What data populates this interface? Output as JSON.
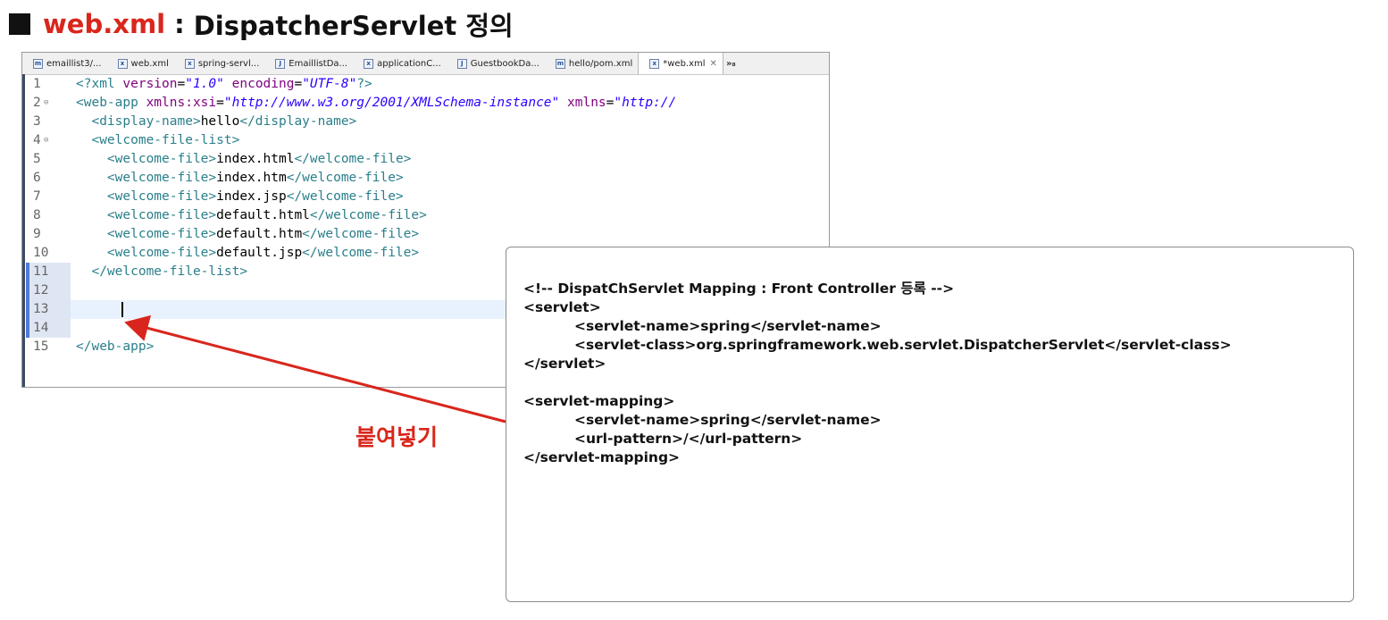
{
  "slide": {
    "title_file": "web.xml",
    "title_separator": ":",
    "title_rest": "DispatcherServlet 정의"
  },
  "colors": {
    "accent_red": "#d9261c",
    "tag_teal": "#2a7f8a",
    "attr_purple": "#7f007f",
    "value_blue": "#2a00ff"
  },
  "editor": {
    "tabs": [
      {
        "label": "emaillist3/...",
        "icon": "maven-pom-icon",
        "icon_letter": "m"
      },
      {
        "label": "web.xml",
        "icon": "xml-file-icon",
        "icon_letter": "x"
      },
      {
        "label": "spring-servl...",
        "icon": "xml-file-icon",
        "icon_letter": "x"
      },
      {
        "label": "EmaillistDa...",
        "icon": "java-file-icon",
        "icon_letter": "J"
      },
      {
        "label": "applicationC...",
        "icon": "xml-file-icon",
        "icon_letter": "x"
      },
      {
        "label": "GuestbookDa...",
        "icon": "java-file-icon",
        "icon_letter": "J"
      },
      {
        "label": "hello/pom.xml",
        "icon": "maven-pom-icon",
        "icon_letter": "m"
      },
      {
        "label": "*web.xml",
        "icon": "xml-file-icon",
        "icon_letter": "x",
        "active": true,
        "close": "✕"
      }
    ],
    "overflow_label": "»₈",
    "lines": [
      {
        "num": "1",
        "tokens": [
          {
            "t": "tag",
            "v": "<?xml "
          },
          {
            "t": "attr",
            "v": "version"
          },
          {
            "t": "txt",
            "v": "="
          },
          {
            "t": "val",
            "v": "\"1.0\""
          },
          {
            "t": "txt",
            "v": " "
          },
          {
            "t": "attr",
            "v": "encoding"
          },
          {
            "t": "txt",
            "v": "="
          },
          {
            "t": "val",
            "v": "\"UTF-8\""
          },
          {
            "t": "tag",
            "v": "?>"
          }
        ]
      },
      {
        "num": "2",
        "fold": "⊖",
        "tokens": [
          {
            "t": "tag",
            "v": "<web-app "
          },
          {
            "t": "attr",
            "v": "xmlns:xsi"
          },
          {
            "t": "txt",
            "v": "="
          },
          {
            "t": "val",
            "v": "\"http://www.w3.org/2001/XMLSchema-instance\""
          },
          {
            "t": "txt",
            "v": " "
          },
          {
            "t": "attr",
            "v": "xmlns"
          },
          {
            "t": "txt",
            "v": "="
          },
          {
            "t": "val",
            "v": "\"http://"
          }
        ]
      },
      {
        "num": "3",
        "tokens": [
          {
            "t": "tag",
            "v": "  <display-name>"
          },
          {
            "t": "txt",
            "v": "hello"
          },
          {
            "t": "tag",
            "v": "</display-name>"
          }
        ]
      },
      {
        "num": "4",
        "fold": "⊖",
        "tokens": [
          {
            "t": "tag",
            "v": "  <welcome-file-list>"
          }
        ]
      },
      {
        "num": "5",
        "tokens": [
          {
            "t": "tag",
            "v": "    <welcome-file>"
          },
          {
            "t": "txt",
            "v": "index.html"
          },
          {
            "t": "tag",
            "v": "</welcome-file>"
          }
        ]
      },
      {
        "num": "6",
        "tokens": [
          {
            "t": "tag",
            "v": "    <welcome-file>"
          },
          {
            "t": "txt",
            "v": "index.htm"
          },
          {
            "t": "tag",
            "v": "</welcome-file>"
          }
        ]
      },
      {
        "num": "7",
        "tokens": [
          {
            "t": "tag",
            "v": "    <welcome-file>"
          },
          {
            "t": "txt",
            "v": "index.jsp"
          },
          {
            "t": "tag",
            "v": "</welcome-file>"
          }
        ]
      },
      {
        "num": "8",
        "tokens": [
          {
            "t": "tag",
            "v": "    <welcome-file>"
          },
          {
            "t": "txt",
            "v": "default.html"
          },
          {
            "t": "tag",
            "v": "</welcome-file>"
          }
        ]
      },
      {
        "num": "9",
        "tokens": [
          {
            "t": "tag",
            "v": "    <welcome-file>"
          },
          {
            "t": "txt",
            "v": "default.htm"
          },
          {
            "t": "tag",
            "v": "</welcome-file>"
          }
        ]
      },
      {
        "num": "10",
        "tokens": [
          {
            "t": "tag",
            "v": "    <welcome-file>"
          },
          {
            "t": "txt",
            "v": "default.jsp"
          },
          {
            "t": "tag",
            "v": "</welcome-file>"
          }
        ]
      },
      {
        "num": "11",
        "changed": true,
        "tokens": [
          {
            "t": "tag",
            "v": "  </welcome-file-list>"
          }
        ]
      },
      {
        "num": "12",
        "changed": true,
        "tokens": []
      },
      {
        "num": "13",
        "changed": true,
        "current": true,
        "tokens": []
      },
      {
        "num": "14",
        "changed": true,
        "tokens": []
      },
      {
        "num": "15",
        "tokens": [
          {
            "t": "tag",
            "v": "</web-app>"
          }
        ]
      }
    ]
  },
  "snippet": {
    "lines": [
      {
        "text": "<!-- DispatChServlet Mapping : Front Controller 등록 -->"
      },
      {
        "text": "<servlet>"
      },
      {
        "text": "<servlet-name>spring</servlet-name>",
        "indent": true
      },
      {
        "text": "<servlet-class>org.springframework.web.servlet.DispatcherServlet</servlet-class>",
        "indent": true
      },
      {
        "text": "</servlet>"
      },
      {
        "text": ""
      },
      {
        "text": "<servlet-mapping>"
      },
      {
        "text": "<servlet-name>spring</servlet-name>",
        "indent": true
      },
      {
        "text": "<url-pattern>/</url-pattern>",
        "indent": true
      },
      {
        "text": "</servlet-mapping>"
      }
    ]
  },
  "annotation": {
    "paste_label": "붙여넣기"
  }
}
